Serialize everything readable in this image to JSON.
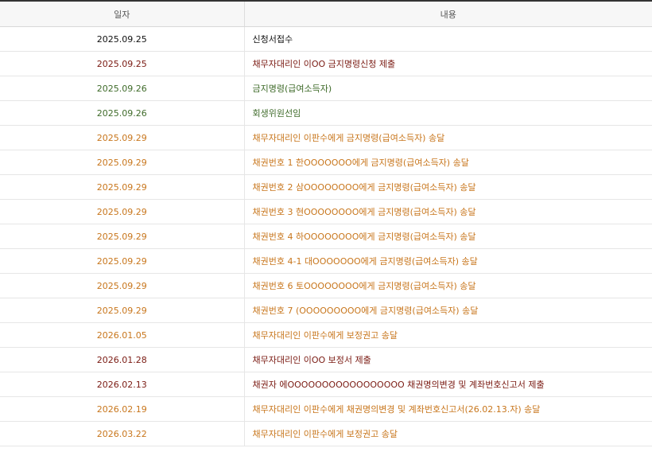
{
  "header": {
    "date_label": "일자",
    "content_label": "내용"
  },
  "colors": {
    "black": "#111111",
    "dark_red": "#7a1a12",
    "green": "#3f6b2a",
    "orange": "#c8761c"
  },
  "rows": [
    {
      "date": "2025.09.25",
      "content": "신청서접수",
      "color": "#111111"
    },
    {
      "date": "2025.09.25",
      "content": "채무자대리인 이OO 금지명령신청 제출",
      "color": "#7a1a12"
    },
    {
      "date": "2025.09.26",
      "content": "금지명령(급여소득자)",
      "color": "#3f6b2a"
    },
    {
      "date": "2025.09.26",
      "content": "회생위원선임",
      "color": "#3f6b2a"
    },
    {
      "date": "2025.09.29",
      "content": "채무자대리인 이판수에게 금지명령(급여소득자) 송달",
      "color": "#c8761c"
    },
    {
      "date": "2025.09.29",
      "content": "채권번호 1 한OOOOOOO에게 금지명령(급여소득자) 송달",
      "color": "#c8761c"
    },
    {
      "date": "2025.09.29",
      "content": "채권번호 2 삼OOOOOOOO에게 금지명령(급여소득자) 송달",
      "color": "#c8761c"
    },
    {
      "date": "2025.09.29",
      "content": "채권번호 3 현OOOOOOOO에게 금지명령(급여소득자) 송달",
      "color": "#c8761c"
    },
    {
      "date": "2025.09.29",
      "content": "채권번호 4 하OOOOOOOO에게 금지명령(급여소득자) 송달",
      "color": "#c8761c"
    },
    {
      "date": "2025.09.29",
      "content": "채권번호 4-1 대OOOOOOO에게 금지명령(급여소득자) 송달",
      "color": "#c8761c"
    },
    {
      "date": "2025.09.29",
      "content": "채권번호 6 토OOOOOOOO에게 금지명령(급여소득자) 송달",
      "color": "#c8761c"
    },
    {
      "date": "2025.09.29",
      "content": "채권번호 7 (OOOOOOOOO에게 금지명령(급여소득자) 송달",
      "color": "#c8761c"
    },
    {
      "date": "2026.01.05",
      "content": "채무자대리인 이판수에게 보정권고 송달",
      "color": "#c8761c"
    },
    {
      "date": "2026.01.28",
      "content": "채무자대리인 이OO 보정서 제출",
      "color": "#7a1a12"
    },
    {
      "date": "2026.02.13",
      "content": "채권자 에OOOOOOOOOOOOOOOOO 채권명의변경 및 계좌번호신고서 제출",
      "color": "#7a1a12"
    },
    {
      "date": "2026.02.19",
      "content": "채무자대리인 이판수에게 채권명의변경 및 계좌번호신고서(26.02.13.자) 송달",
      "color": "#c8761c"
    },
    {
      "date": "2026.03.22",
      "content": "채무자대리인 이판수에게 보정권고 송달",
      "color": "#c8761c"
    }
  ]
}
